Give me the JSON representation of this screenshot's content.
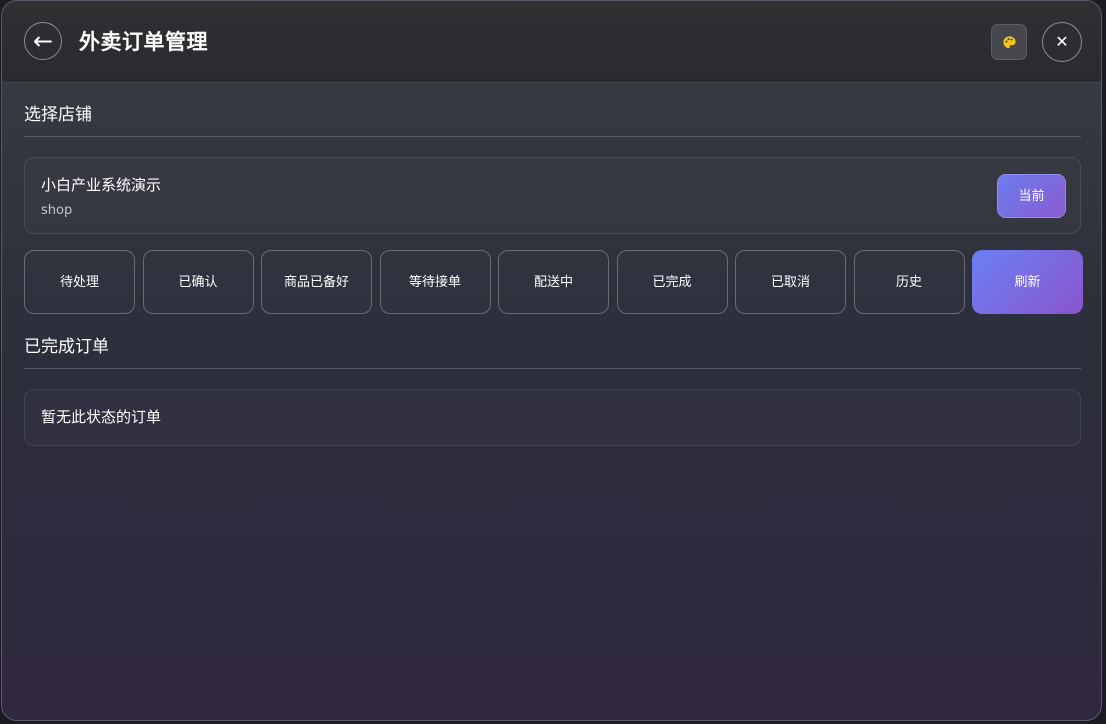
{
  "header": {
    "back_icon": "arrow-left-icon",
    "back_glyph": "←",
    "title": "外卖订单管理",
    "theme_icon": "palette-icon",
    "close_icon": "close-icon",
    "close_glyph": "✕"
  },
  "shop_section": {
    "title": "选择店铺",
    "shop": {
      "name": "小白产业系统演示",
      "sub": "shop",
      "button_label": "当前"
    }
  },
  "tabs": [
    {
      "label": "待处理"
    },
    {
      "label": "已确认"
    },
    {
      "label": "商品已备好"
    },
    {
      "label": "等待接单"
    },
    {
      "label": "配送中"
    },
    {
      "label": "已完成"
    },
    {
      "label": "已取消"
    },
    {
      "label": "历史"
    },
    {
      "label": "刷新"
    }
  ],
  "orders_section": {
    "title": "已完成订单",
    "empty_text": "暂无此状态的订单"
  },
  "colors": {
    "accent_start": "#6b80f5",
    "accent_end": "#8a55cc",
    "palette_icon": "#f5c518"
  }
}
